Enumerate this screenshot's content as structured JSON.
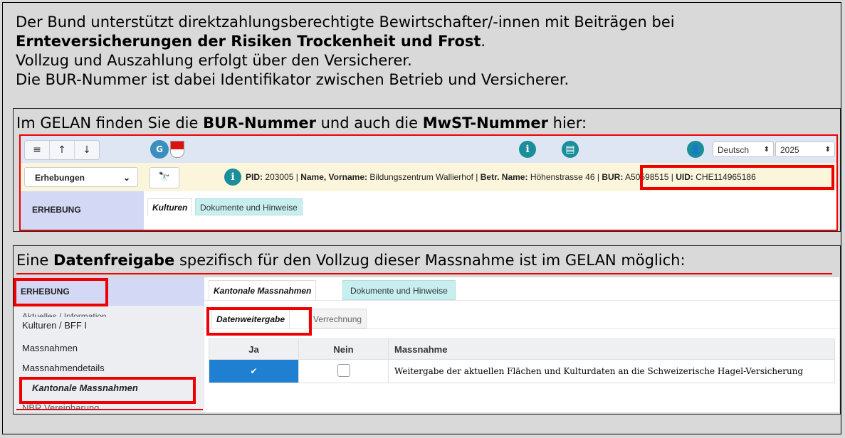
{
  "intro": {
    "line1": "Der Bund unterstützt direktzahlungsberechtigte Bewirtschafter/-innen mit Beiträgen bei",
    "line2_bold": "Ernteversicherungen der Risiken Trockenheit und Frost",
    "line2_end": ".",
    "line3": "Vollzug und Auszahlung erfolgt über den Versicherer.",
    "line4": "Die BUR-Nummer ist dabei Identifikator zwischen Betrieb und Versicherer."
  },
  "section1": {
    "caption_pre": "Im GELAN finden Sie die ",
    "caption_bold1": "BUR-Nummer",
    "caption_mid": " und auch die ",
    "caption_bold2": "MwST-Nummer",
    "caption_post": " hier:",
    "toolbar": {
      "menu_icon": "≡",
      "up_icon": "↑",
      "down_icon": "↓",
      "logo_text": "G",
      "info_icon": "i",
      "doc_icon": "▤",
      "user_icon": "👤",
      "language": "Deutsch",
      "year": "2025"
    },
    "infobar": {
      "dropdown": "Erhebungen",
      "pid_label": "PID:",
      "pid_value": "203005",
      "name_label": "Name, Vorname:",
      "name_value": "Bildungszentrum Wallierhof",
      "betr_label": "Betr. Name:",
      "betr_value": "Höhenstrasse 46",
      "bur_label": "BUR:",
      "bur_value": "A50598515",
      "uid_label": "UID:",
      "uid_value": "CHE114965186",
      "sep": " | "
    },
    "sidebar_title": "ERHEBUNG",
    "tabs": [
      "Kulturen",
      "Dokumente und Hinweise"
    ]
  },
  "section2": {
    "caption_pre": "Eine ",
    "caption_bold": "Datenfreigabe",
    "caption_post": " spezifisch für den Vollzug dieser Massnahme ist im GELAN möglich:",
    "sidebar_title": "ERHEBUNG",
    "sidebar_items": [
      "Aktuelles / Information",
      "Kulturen / BFF I",
      "Massnahmen",
      "Massnahmendetails",
      "Kantonale Massnahmen",
      "NBR Vereinbarung"
    ],
    "tabs": [
      "Kantonale Massnahmen",
      "Dokumente und Hinweise"
    ],
    "subtabs": [
      "Datenweitergabe",
      "Verrechnung"
    ],
    "table": {
      "headers": [
        "Ja",
        "Nein",
        "Massnahme"
      ],
      "rows": [
        {
          "ja": true,
          "nein": false,
          "massnahme": "Weitergabe der aktuellen Flächen und Kulturdaten an die Schweizerische Hagel-Versicherung"
        }
      ]
    }
  }
}
